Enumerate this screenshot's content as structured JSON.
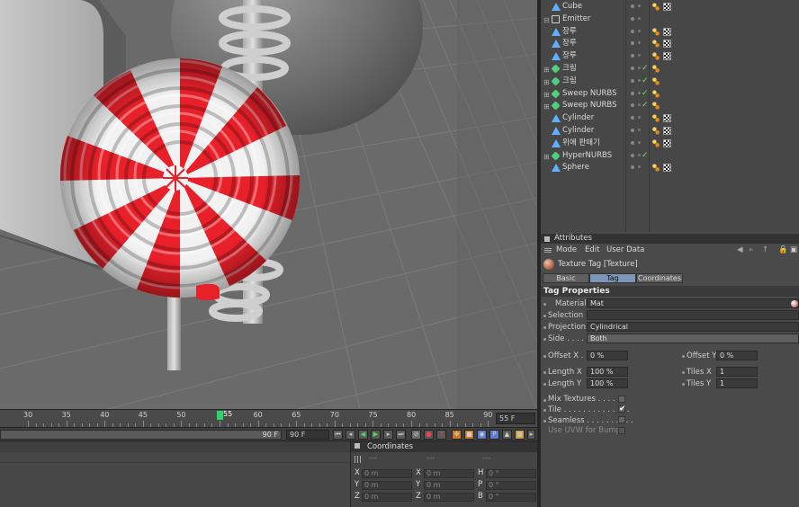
{
  "timeline": {
    "ticks": [
      "30",
      "35",
      "40",
      "45",
      "50",
      "55",
      "60",
      "65",
      "70",
      "75",
      "80",
      "85",
      "90"
    ],
    "current": "55",
    "current_field": "55 F"
  },
  "transport": {
    "range_end": "90 F",
    "end_field": "90 F"
  },
  "objects": [
    {
      "name": "Cube",
      "tree": "",
      "icon": "cube-icon",
      "checked": false,
      "tags": 2
    },
    {
      "name": "Emitter",
      "tree": "⊟",
      "icon": "emitter-icon",
      "checked": false,
      "tags": 0
    },
    {
      "name": "장루",
      "tree": "",
      "icon": "object-icon",
      "checked": false,
      "tags": 2
    },
    {
      "name": "장루",
      "tree": "",
      "icon": "object-icon",
      "checked": false,
      "tags": 2
    },
    {
      "name": "장루",
      "tree": "",
      "icon": "object-icon",
      "checked": false,
      "tags": 2
    },
    {
      "name": "크림",
      "tree": "⊞",
      "icon": "generator-icon",
      "checked": true,
      "tags": 1
    },
    {
      "name": "크림",
      "tree": "⊞",
      "icon": "generator-icon",
      "checked": true,
      "tags": 1
    },
    {
      "name": "Sweep NURBS",
      "tree": "⊞",
      "icon": "sweep-nurbs-icon",
      "checked": true,
      "tags": 1
    },
    {
      "name": "Sweep NURBS",
      "tree": "⊞",
      "icon": "sweep-nurbs-icon",
      "checked": true,
      "tags": 1
    },
    {
      "name": "Cylinder",
      "tree": "",
      "icon": "cylinder-icon",
      "checked": false,
      "tags": 2
    },
    {
      "name": "Cylinder",
      "tree": "",
      "icon": "cylinder-icon",
      "checked": false,
      "tags": 2
    },
    {
      "name": "위에 판때기",
      "tree": "",
      "icon": "object-icon",
      "checked": false,
      "tags": 2
    },
    {
      "name": "HyperNURBS",
      "tree": "⊞",
      "icon": "hypernurbs-icon",
      "checked": true,
      "tags": 0
    },
    {
      "name": "Sphere",
      "tree": "",
      "icon": "sphere-icon",
      "checked": false,
      "tags": 2
    }
  ],
  "attributes": {
    "panel_title": "Attributes",
    "menu": [
      "Mode",
      "Edit",
      "User Data"
    ],
    "tag_title": "Texture Tag [Texture]",
    "tabs": [
      "Basic",
      "Tag",
      "Coordinates"
    ],
    "active_tab": "Tag",
    "section": "Tag Properties",
    "material_label": "Material",
    "material_value": "Mat",
    "selection_label": "Selection",
    "selection_value": "",
    "projection_label": "Projection",
    "projection_value": "Cylindrical",
    "side_label": "Side . . . . .",
    "side_value": "Both",
    "offset_x_label": "Offset X . .",
    "offset_x_value": "0 %",
    "offset_y_label": "Offset Y",
    "offset_y_value": "0 %",
    "length_x_label": "Length X",
    "length_x_value": "100 %",
    "length_y_label": "Length Y",
    "length_y_value": "100 %",
    "tiles_x_label": "Tiles X",
    "tiles_x_value": "1",
    "tiles_y_label": "Tiles Y",
    "tiles_y_value": "1",
    "mix_label": "Mix Textures . . . . . .",
    "tile_label": "Tile . . . . . . . . . . . . . .",
    "seamless_label": "Seamless . . . . . . . . . .",
    "uvw_label": "Use UVW for Bump"
  },
  "coordinates": {
    "title": "Coordinates",
    "headers": [
      "---",
      "---",
      "---"
    ],
    "rows": [
      {
        "a1": "X",
        "v1": "0 m",
        "a2": "X",
        "v2": "0 m",
        "a3": "H",
        "v3": "0 °"
      },
      {
        "a1": "Y",
        "v1": "0 m",
        "a2": "Y",
        "v2": "0 m",
        "a3": "P",
        "v3": "0 °"
      },
      {
        "a1": "Z",
        "v1": "0 m",
        "a2": "Z",
        "v2": "0 m",
        "a3": "B",
        "v3": "0 °"
      }
    ]
  },
  "colors": {
    "candy_red": "#e8202a",
    "candy_white": "#f2f2f2",
    "floor": "#6a6a6a",
    "accent_green": "#29d66b",
    "tab_active": "#7b96b8"
  }
}
